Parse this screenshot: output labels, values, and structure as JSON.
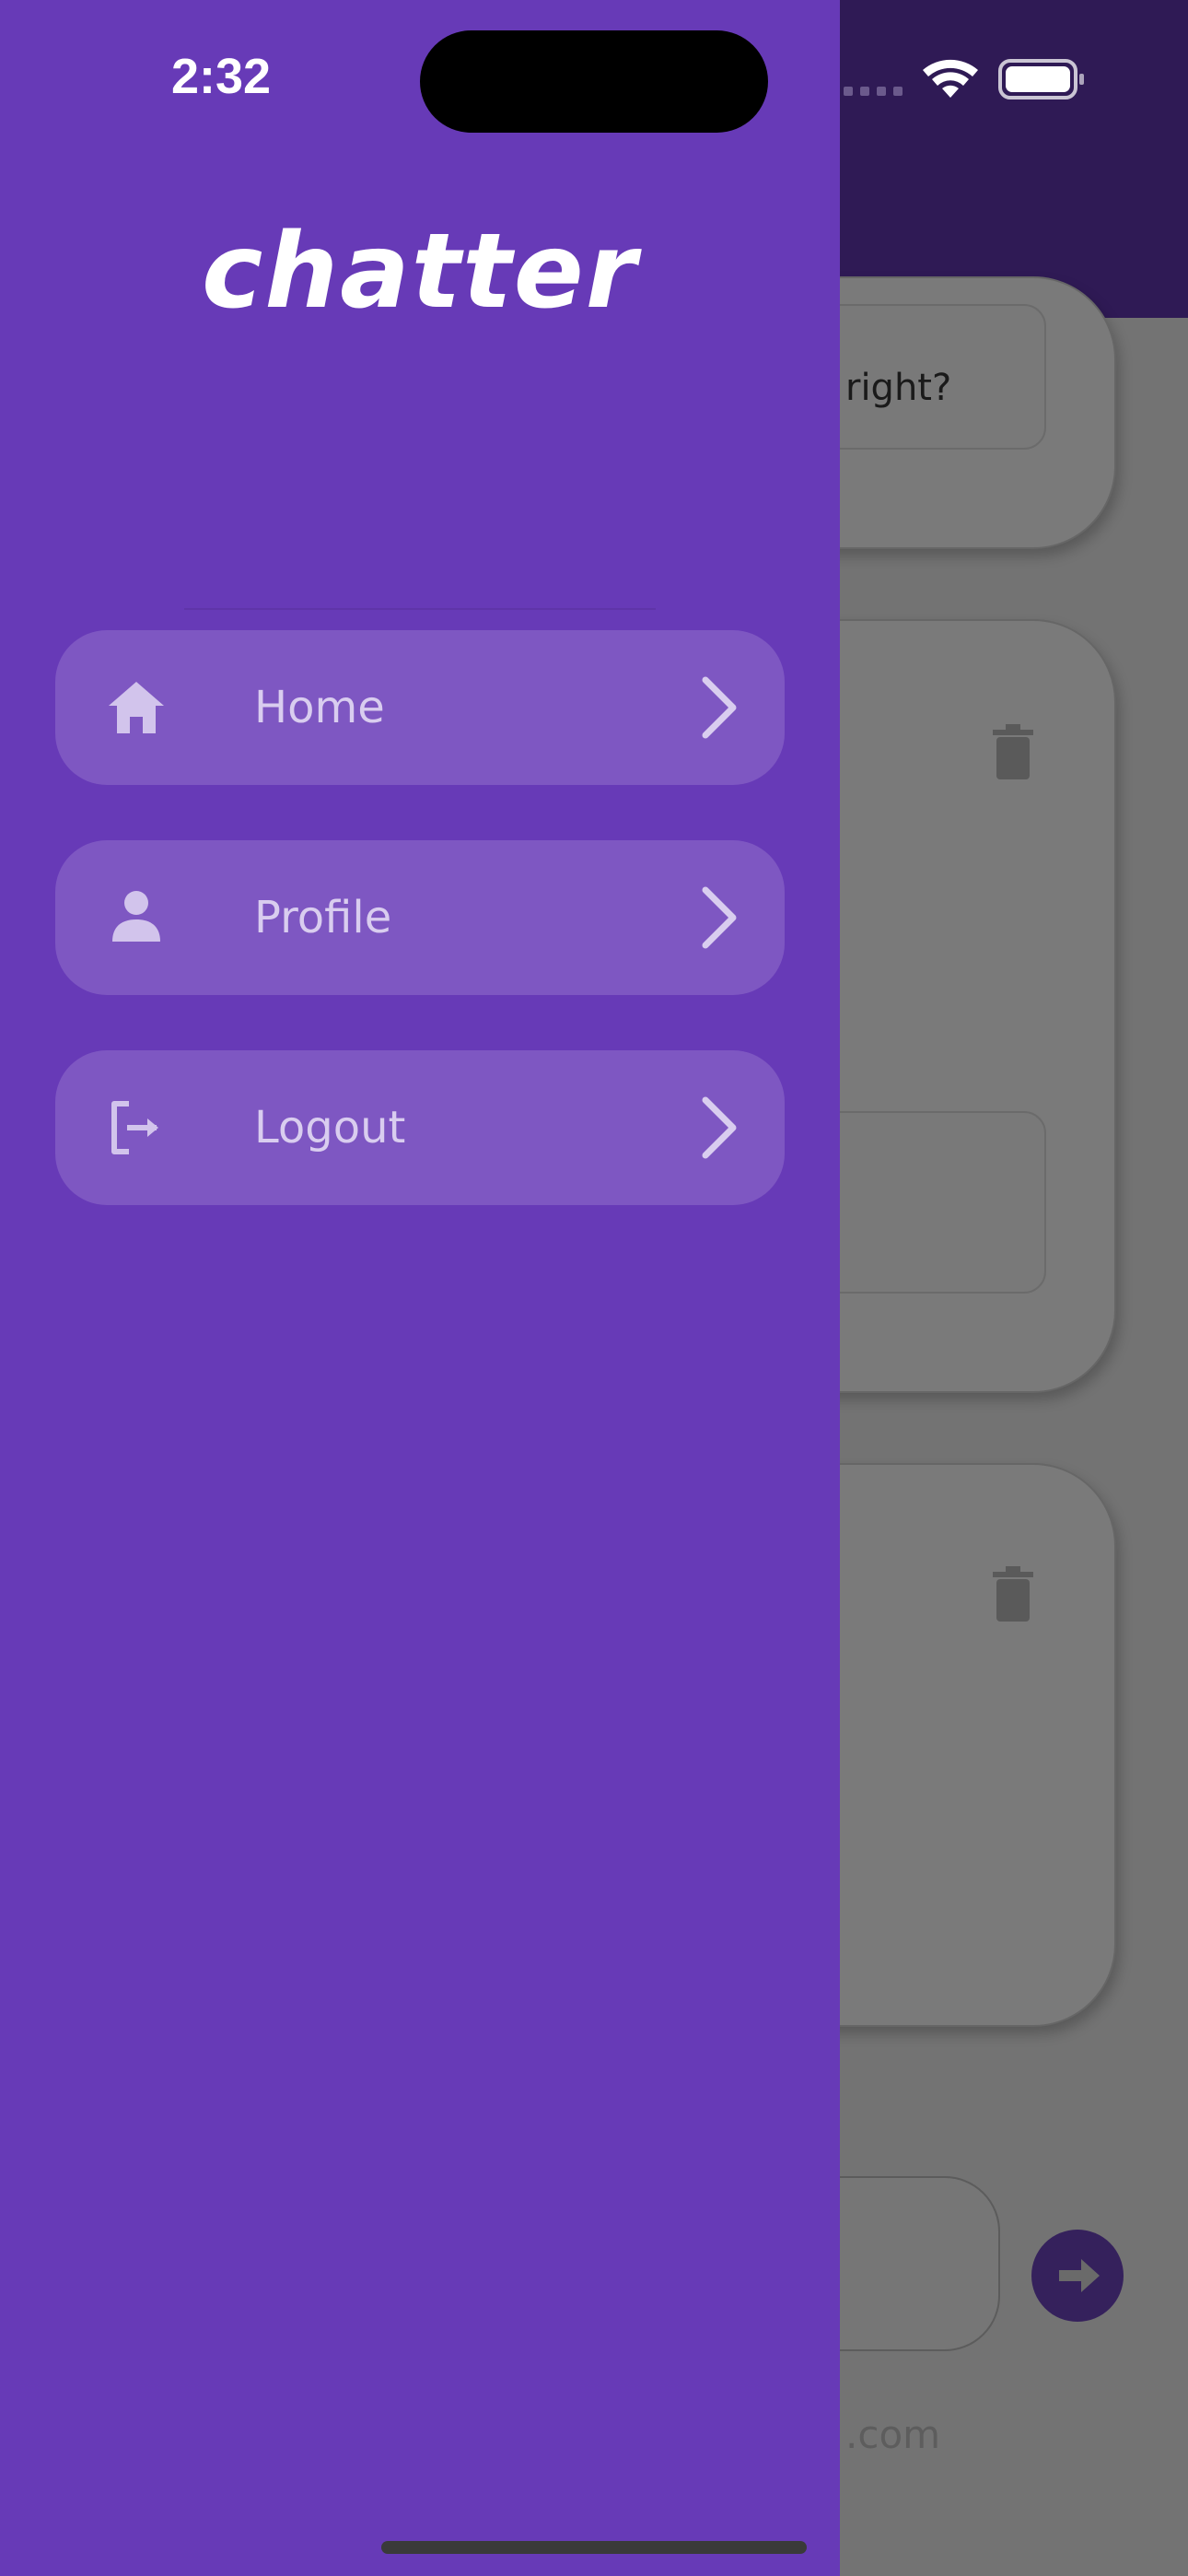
{
  "status_bar": {
    "time": "2:32",
    "icons": [
      "signal-icon",
      "wifi-icon",
      "battery-icon"
    ]
  },
  "drawer": {
    "logo": "chatter",
    "menu": [
      {
        "label": "Home",
        "icon": "home-icon"
      },
      {
        "label": "Profile",
        "icon": "person-icon"
      },
      {
        "label": "Logout",
        "icon": "logout-icon"
      }
    ]
  },
  "background": {
    "post_text": "right?",
    "footer_text": ".com"
  },
  "colors": {
    "drawer": "#673ab7",
    "menu_item": "#7e57c2",
    "menu_text": "#d9cdef",
    "header": "#2f1a55"
  }
}
